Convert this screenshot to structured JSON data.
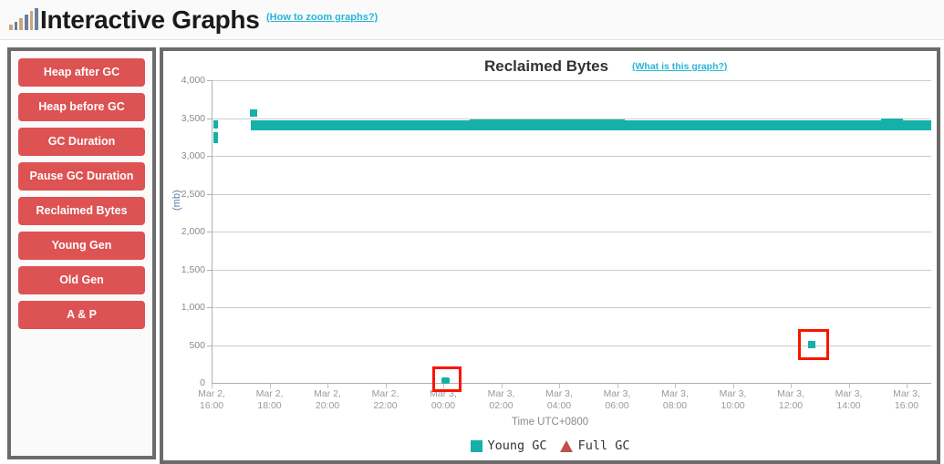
{
  "header": {
    "icon": "bar-chart-icon",
    "title": "Interactive Graphs",
    "help_link": "(How to zoom graphs?)"
  },
  "sidebar": {
    "buttons": [
      {
        "label": "Heap after GC"
      },
      {
        "label": "Heap before GC"
      },
      {
        "label": "GC Duration"
      },
      {
        "label": "Pause GC Duration"
      },
      {
        "label": "Reclaimed Bytes"
      },
      {
        "label": "Young Gen"
      },
      {
        "label": "Old Gen"
      },
      {
        "label": "A & P"
      }
    ],
    "accent_color": "#dd5252"
  },
  "chart_panel": {
    "title": "Reclaimed Bytes",
    "help_link": "(What is this graph?)"
  },
  "chart_data": {
    "type": "scatter",
    "title": "Reclaimed Bytes",
    "xlabel": "Time UTC+0800",
    "ylabel": "(mb)",
    "ylim": [
      0,
      4000
    ],
    "ytick_labels": [
      "0",
      "500",
      "1,000",
      "1,500",
      "2,000",
      "2,500",
      "3,000",
      "3,500",
      "4,000"
    ],
    "ytick_values": [
      0,
      500,
      1000,
      1500,
      2000,
      2500,
      3000,
      3500,
      4000
    ],
    "grid": true,
    "xtick_labels": [
      "Mar 2,\n16:00",
      "Mar 2,\n18:00",
      "Mar 2,\n20:00",
      "Mar 2,\n22:00",
      "Mar 3,\n00:00",
      "Mar 3,\n02:00",
      "Mar 3,\n04:00",
      "Mar 3,\n06:00",
      "Mar 3,\n08:00",
      "Mar 3,\n10:00",
      "Mar 3,\n12:00",
      "Mar 3,\n14:00",
      "Mar 3,\n16:00"
    ],
    "xticks_top": [
      "Mar 2,",
      "Mar 2,",
      "Mar 2,",
      "Mar 2,",
      "Mar 3,",
      "Mar 3,",
      "Mar 3,",
      "Mar 3,",
      "Mar 3,",
      "Mar 3,",
      "Mar 3,",
      "Mar 3,",
      "Mar 3,"
    ],
    "xticks_bottom": [
      "16:00",
      "18:00",
      "20:00",
      "22:00",
      "00:00",
      "02:00",
      "04:00",
      "06:00",
      "08:00",
      "10:00",
      "12:00",
      "14:00",
      "16:00"
    ],
    "xlim": [
      "Mar 2 16:00",
      "Mar 3 16:00"
    ],
    "legend": [
      {
        "name": "Young GC",
        "color": "#16b0a8",
        "marker": "square"
      },
      {
        "name": "Full GC",
        "color": "#c0504d",
        "marker": "triangle"
      }
    ],
    "legend_position": "bottom",
    "series": [
      {
        "name": "Young GC",
        "color": "#16b0a8",
        "description": "Dense cluster of reclaimed-byte samples around 3,400-3,480 mb spanning Mar 2 17:00 to Mar 3 16:00, with two gaps near Mar 3 08:40-09:45 and Mar 3 10:10-10:35, plus isolated low outliers.",
        "notable_points": [
          {
            "x": "Mar 2 16:00",
            "y": 3450
          },
          {
            "x": "Mar 2 16:00",
            "y": 3280
          },
          {
            "x": "Mar 2 17:00",
            "y": 3600
          },
          {
            "x": "Mar 3 00:00",
            "y": 40
          },
          {
            "x": "Mar 3 12:30",
            "y": 560
          }
        ],
        "band_level": 3430
      },
      {
        "name": "Full GC",
        "color": "#c0504d",
        "notable_points": []
      }
    ],
    "annotations": [
      {
        "label": "highlight-box-1",
        "x": "Mar 3 00:00",
        "y": 40,
        "color": "#fa1500"
      },
      {
        "label": "highlight-box-2",
        "x": "Mar 3 12:30",
        "y": 560,
        "color": "#fa1500"
      }
    ]
  }
}
